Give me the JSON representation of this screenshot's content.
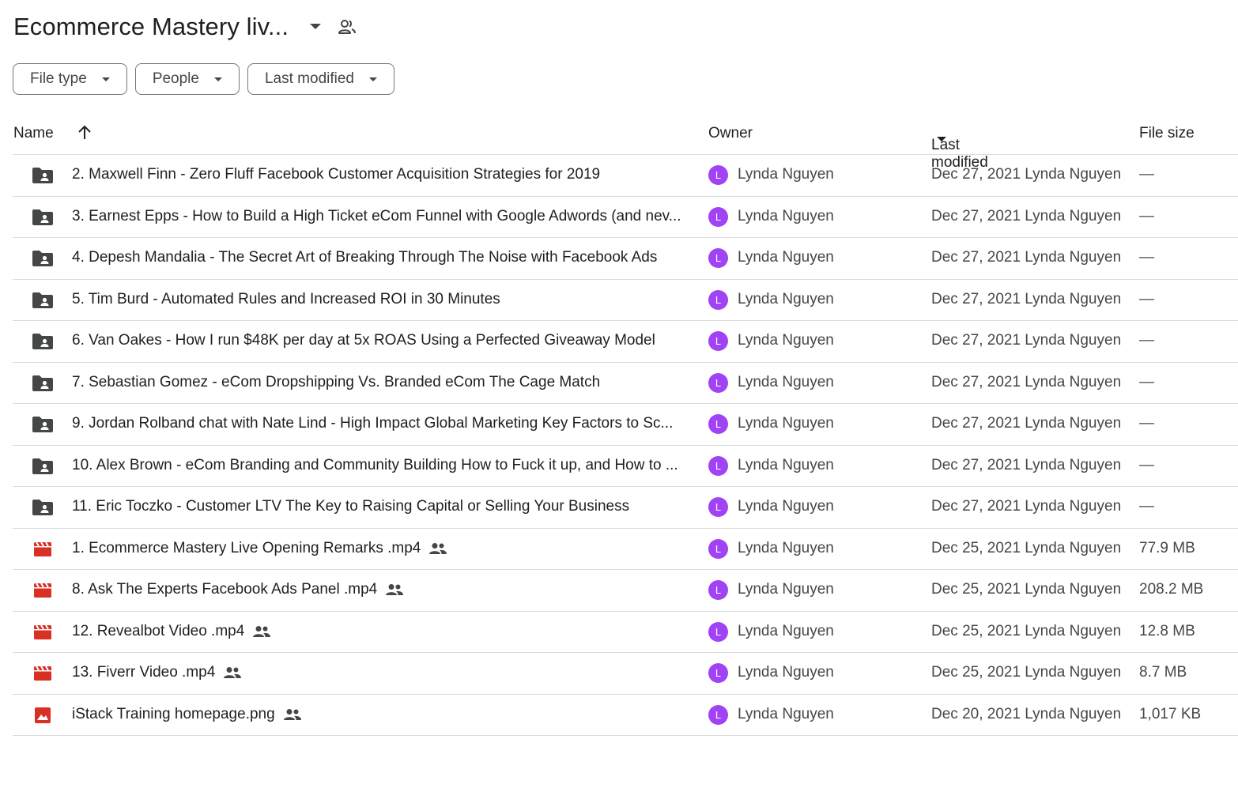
{
  "header": {
    "title": "Ecommerce Mastery liv...",
    "caret_icon": "arrow-drop-down-icon",
    "shared_icon": "shared-people-icon"
  },
  "filters": [
    {
      "label": "File type"
    },
    {
      "label": "People"
    },
    {
      "label": "Last modified"
    }
  ],
  "columns": {
    "name": "Name",
    "owner": "Owner",
    "last_modified": "Last modified",
    "file_size": "File size",
    "sort": "ascending"
  },
  "colors": {
    "folder": "#444746",
    "video": "#d93025",
    "image": "#d93025",
    "avatar": "#a142f4",
    "divider": "#dadce0"
  },
  "rows": [
    {
      "type": "folder",
      "name": "2. Maxwell Finn - Zero Fluff Facebook Customer Acquisition Strategies for 2019",
      "shared": false,
      "owner": "Lynda Nguyen",
      "avatar": "L",
      "modified": "Dec 27, 2021 Lynda Nguyen",
      "size": "—"
    },
    {
      "type": "folder",
      "name": "3. Earnest Epps - How to Build a High Ticket eCom Funnel with Google Adwords (and nev...",
      "shared": false,
      "owner": "Lynda Nguyen",
      "avatar": "L",
      "modified": "Dec 27, 2021 Lynda Nguyen",
      "size": "—"
    },
    {
      "type": "folder",
      "name": "4. Depesh Mandalia - The Secret Art of Breaking Through The Noise with Facebook Ads",
      "shared": false,
      "owner": "Lynda Nguyen",
      "avatar": "L",
      "modified": "Dec 27, 2021 Lynda Nguyen",
      "size": "—"
    },
    {
      "type": "folder",
      "name": "5. Tim Burd - Automated Rules and Increased ROI in 30 Minutes",
      "shared": false,
      "owner": "Lynda Nguyen",
      "avatar": "L",
      "modified": "Dec 27, 2021 Lynda Nguyen",
      "size": "—"
    },
    {
      "type": "folder",
      "name": "6. Van Oakes - How I run $48K per day at 5x ROAS Using a Perfected Giveaway Model",
      "shared": false,
      "owner": "Lynda Nguyen",
      "avatar": "L",
      "modified": "Dec 27, 2021 Lynda Nguyen",
      "size": "—"
    },
    {
      "type": "folder",
      "name": "7. Sebastian Gomez - eCom Dropshipping Vs. Branded eCom The Cage Match",
      "shared": false,
      "owner": "Lynda Nguyen",
      "avatar": "L",
      "modified": "Dec 27, 2021 Lynda Nguyen",
      "size": "—"
    },
    {
      "type": "folder",
      "name": "9. Jordan Rolband chat with Nate Lind - High Impact Global Marketing Key Factors to Sc...",
      "shared": false,
      "owner": "Lynda Nguyen",
      "avatar": "L",
      "modified": "Dec 27, 2021 Lynda Nguyen",
      "size": "—"
    },
    {
      "type": "folder",
      "name": "10. Alex Brown - eCom Branding and Community Building How to Fuck it up, and How to ...",
      "shared": false,
      "owner": "Lynda Nguyen",
      "avatar": "L",
      "modified": "Dec 27, 2021 Lynda Nguyen",
      "size": "—"
    },
    {
      "type": "folder",
      "name": "11. Eric Toczko - Customer LTV The Key to Raising Capital or Selling Your Business",
      "shared": false,
      "owner": "Lynda Nguyen",
      "avatar": "L",
      "modified": "Dec 27, 2021 Lynda Nguyen",
      "size": "—"
    },
    {
      "type": "video",
      "name": "1. Ecommerce Mastery Live Opening Remarks .mp4",
      "shared": true,
      "owner": "Lynda Nguyen",
      "avatar": "L",
      "modified": "Dec 25, 2021 Lynda Nguyen",
      "size": "77.9 MB"
    },
    {
      "type": "video",
      "name": "8. Ask The Experts Facebook Ads Panel .mp4",
      "shared": true,
      "owner": "Lynda Nguyen",
      "avatar": "L",
      "modified": "Dec 25, 2021 Lynda Nguyen",
      "size": "208.2 MB"
    },
    {
      "type": "video",
      "name": "12. Revealbot Video .mp4",
      "shared": true,
      "owner": "Lynda Nguyen",
      "avatar": "L",
      "modified": "Dec 25, 2021 Lynda Nguyen",
      "size": "12.8 MB"
    },
    {
      "type": "video",
      "name": "13. Fiverr Video .mp4",
      "shared": true,
      "owner": "Lynda Nguyen",
      "avatar": "L",
      "modified": "Dec 25, 2021 Lynda Nguyen",
      "size": "8.7 MB"
    },
    {
      "type": "image",
      "name": "iStack Training homepage.png",
      "shared": true,
      "owner": "Lynda Nguyen",
      "avatar": "L",
      "modified": "Dec 20, 2021 Lynda Nguyen",
      "size": "1,017 KB"
    }
  ]
}
